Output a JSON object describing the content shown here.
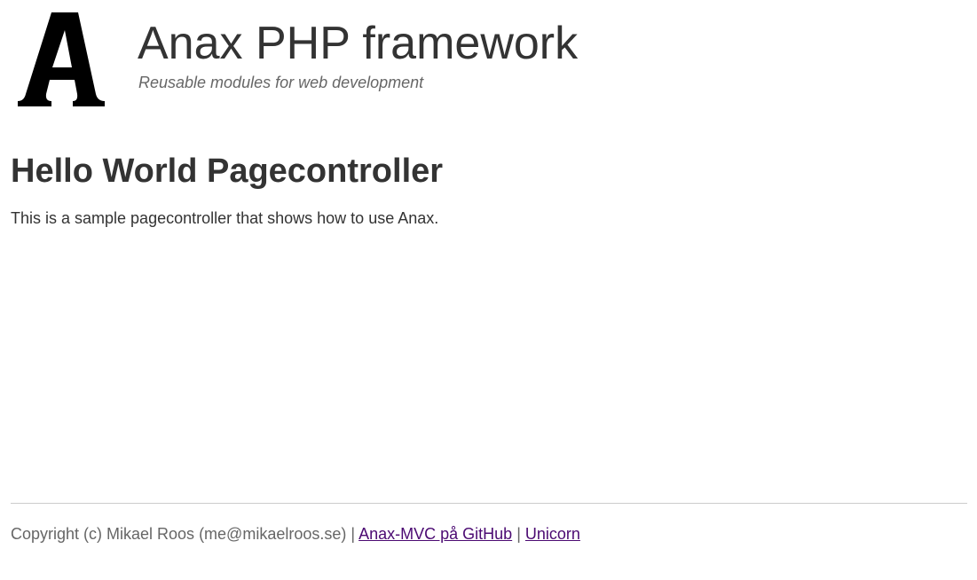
{
  "header": {
    "logo_letter": "A",
    "site_title": "Anax PHP framework",
    "site_slogan": "Reusable modules for web development"
  },
  "main": {
    "heading": "Hello World Pagecontroller",
    "intro": "This is a sample pagecontroller that shows how to use Anax."
  },
  "footer": {
    "copyright": "Copyright (c) Mikael Roos (me@mikaelroos.se)",
    "separator": "|",
    "links": [
      {
        "label": "Anax-MVC på GitHub"
      },
      {
        "label": "Unicorn"
      }
    ]
  },
  "colors": {
    "text": "#333333",
    "muted": "#666666",
    "link_visited": "#4b0a72",
    "rule": "#cccccc"
  }
}
